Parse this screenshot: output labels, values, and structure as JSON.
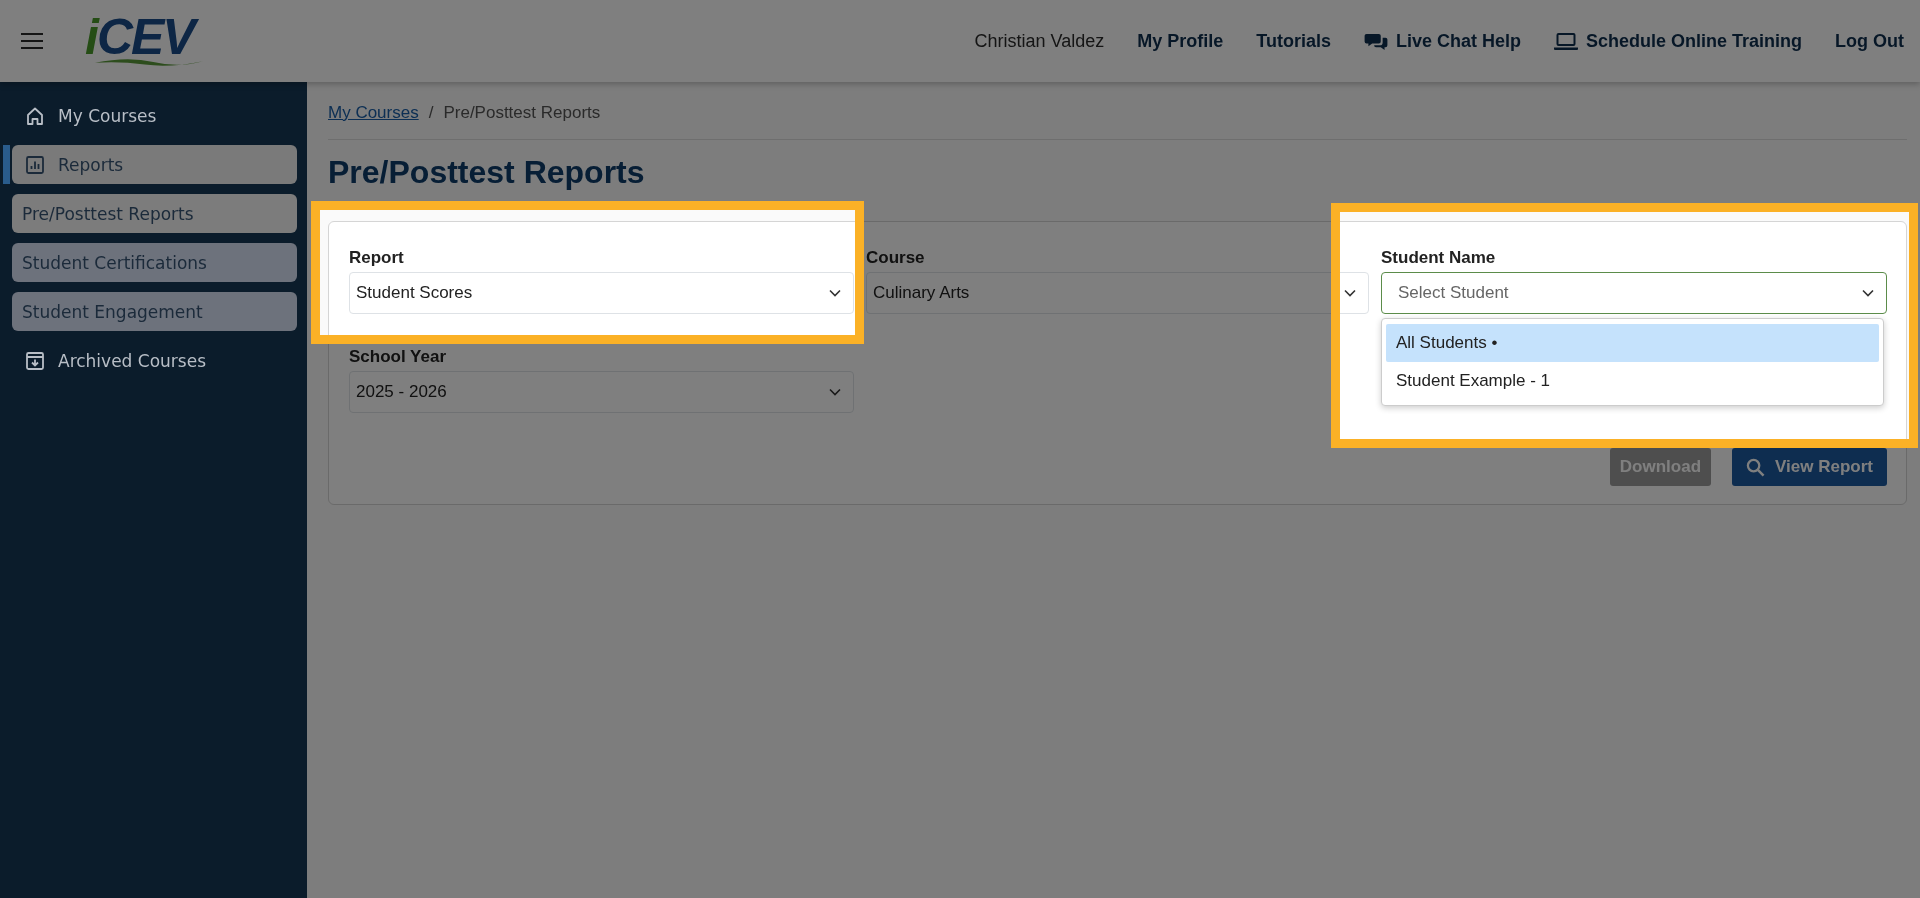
{
  "header": {
    "logo": "iCEV",
    "user_name": "Christian Valdez",
    "links": [
      {
        "label": "My Profile"
      },
      {
        "label": "Tutorials"
      },
      {
        "label": "Live Chat Help",
        "kind": "chat"
      },
      {
        "label": "Schedule Online Training",
        "kind": "laptop"
      },
      {
        "label": "Log Out"
      }
    ]
  },
  "sidebar": {
    "items": [
      {
        "label": "My Courses",
        "kind": "home",
        "selected": false
      },
      {
        "label": "Reports",
        "kind": "chart",
        "selected": true,
        "children": [
          {
            "label": "Pre/Posttest Reports",
            "selected": true
          },
          {
            "label": "Student Certifications",
            "selected": false
          },
          {
            "label": "Student Engagement",
            "selected": false
          }
        ]
      },
      {
        "label": "Archived Courses",
        "kind": "archive",
        "selected": false
      }
    ]
  },
  "breadcrumb": {
    "separator": "/",
    "items": [
      {
        "label": "My Courses",
        "link": true
      },
      {
        "label": "Pre/Posttest Reports",
        "link": false
      }
    ]
  },
  "page_title": "Pre/Posttest Reports",
  "form": {
    "rows": [
      [
        {
          "label": "Report",
          "value": "Student Scores",
          "highlighted": true
        },
        {
          "label": "Course",
          "value": "Culinary Arts",
          "highlighted": false
        },
        {
          "label": "Student Name",
          "placeholder": "Select Student",
          "highlighted": true,
          "open": true,
          "options": [
            {
              "label": "All Students •",
              "selected": true
            },
            {
              "label": "Student Example - 1",
              "selected": false
            }
          ]
        }
      ],
      [
        {
          "label": "School Year",
          "value": "2025 - 2026",
          "highlighted": false
        }
      ]
    ],
    "buttons": [
      {
        "label": "Download",
        "disabled": true
      },
      {
        "label": "View Report",
        "kind": "search",
        "disabled": false
      }
    ]
  }
}
